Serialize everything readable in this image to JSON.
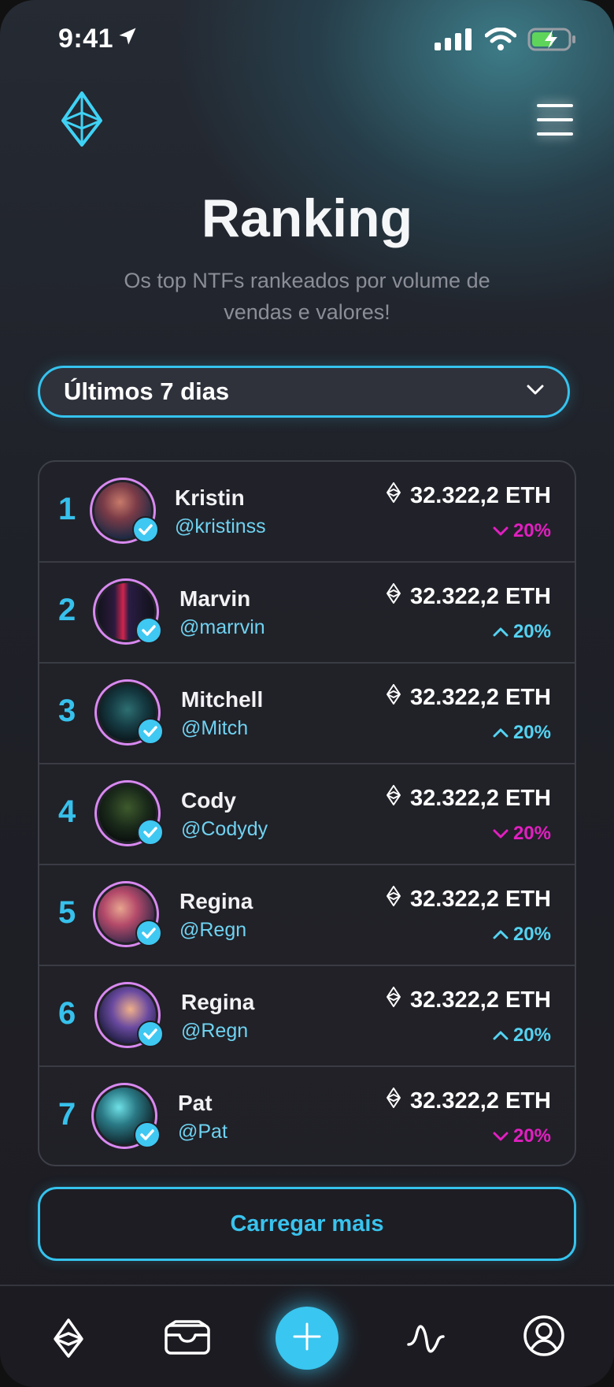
{
  "status_bar": {
    "time": "9:41"
  },
  "header": {
    "title": "Ranking",
    "subtitle": "Os top NTFs rankeados por volume de vendas e valores!"
  },
  "filter": {
    "selected": "Últimos 7 dias"
  },
  "colors": {
    "accent": "#35c3ee",
    "negative": "#e21fc1",
    "positive": "#54d3f2",
    "avatar_ring": "#d889f0"
  },
  "ranking": [
    {
      "rank": "1",
      "name": "Kristin",
      "handle": "@kristinss",
      "amount": "32.322,2 ETH",
      "change": "20%",
      "direction": "down"
    },
    {
      "rank": "2",
      "name": "Marvin",
      "handle": "@marrvin",
      "amount": "32.322,2 ETH",
      "change": "20%",
      "direction": "up"
    },
    {
      "rank": "3",
      "name": "Mitchell",
      "handle": "@Mitch",
      "amount": "32.322,2 ETH",
      "change": "20%",
      "direction": "up"
    },
    {
      "rank": "4",
      "name": "Cody",
      "handle": "@Codydy",
      "amount": "32.322,2 ETH",
      "change": "20%",
      "direction": "down"
    },
    {
      "rank": "5",
      "name": "Regina",
      "handle": "@Regn",
      "amount": "32.322,2 ETH",
      "change": "20%",
      "direction": "up"
    },
    {
      "rank": "6",
      "name": "Regina",
      "handle": "@Regn",
      "amount": "32.322,2 ETH",
      "change": "20%",
      "direction": "up"
    },
    {
      "rank": "7",
      "name": "Pat",
      "handle": "@Pat",
      "amount": "32.322,2 ETH",
      "change": "20%",
      "direction": "down"
    }
  ],
  "load_more_label": "Carregar mais",
  "tabbar": {
    "items": [
      "ethereum-icon",
      "wallet-icon",
      "plus-icon",
      "activity-icon",
      "profile-icon"
    ]
  }
}
